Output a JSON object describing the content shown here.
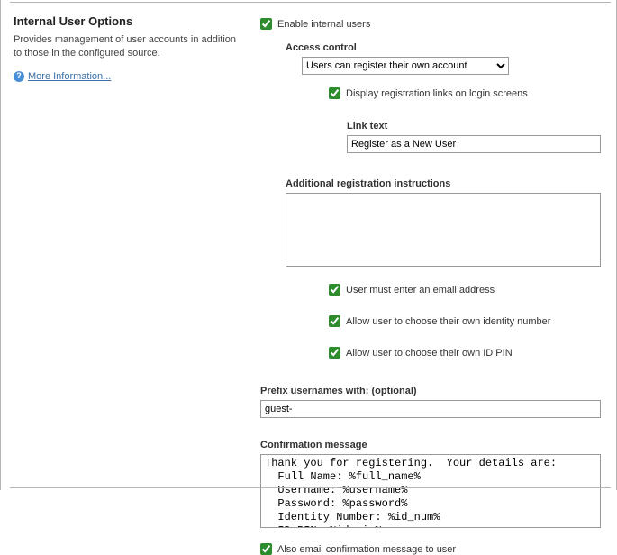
{
  "left": {
    "title": "Internal User Options",
    "description": "Provides management of user accounts in addition to those in the configured source.",
    "more_info": "More Information..."
  },
  "form": {
    "enable_label": "Enable internal users",
    "enable_checked": true,
    "access_control_label": "Access control",
    "access_control_selected": "Users can register their own account",
    "display_links_label": "Display registration links on login screens",
    "display_links_checked": true,
    "link_text_label": "Link text",
    "link_text_value": "Register as a New User",
    "additional_instructions_label": "Additional registration instructions",
    "additional_instructions_value": "",
    "must_email_label": "User must enter an email address",
    "must_email_checked": true,
    "choose_identity_label": "Allow user to choose their own identity number",
    "choose_identity_checked": true,
    "choose_pin_label": "Allow user to choose their own ID PIN",
    "choose_pin_checked": true,
    "prefix_label": "Prefix usernames with: (optional)",
    "prefix_value": "guest-",
    "confirm_label": "Confirmation message",
    "confirm_value": "Thank you for registering.  Your details are:\n  Full Name: %full_name%\n  Username: %username%\n  Password: %password%\n  Identity Number: %id_num%\n  ID PIN: %id_pin%",
    "also_email_label": "Also email confirmation message to user",
    "also_email_checked": true
  }
}
